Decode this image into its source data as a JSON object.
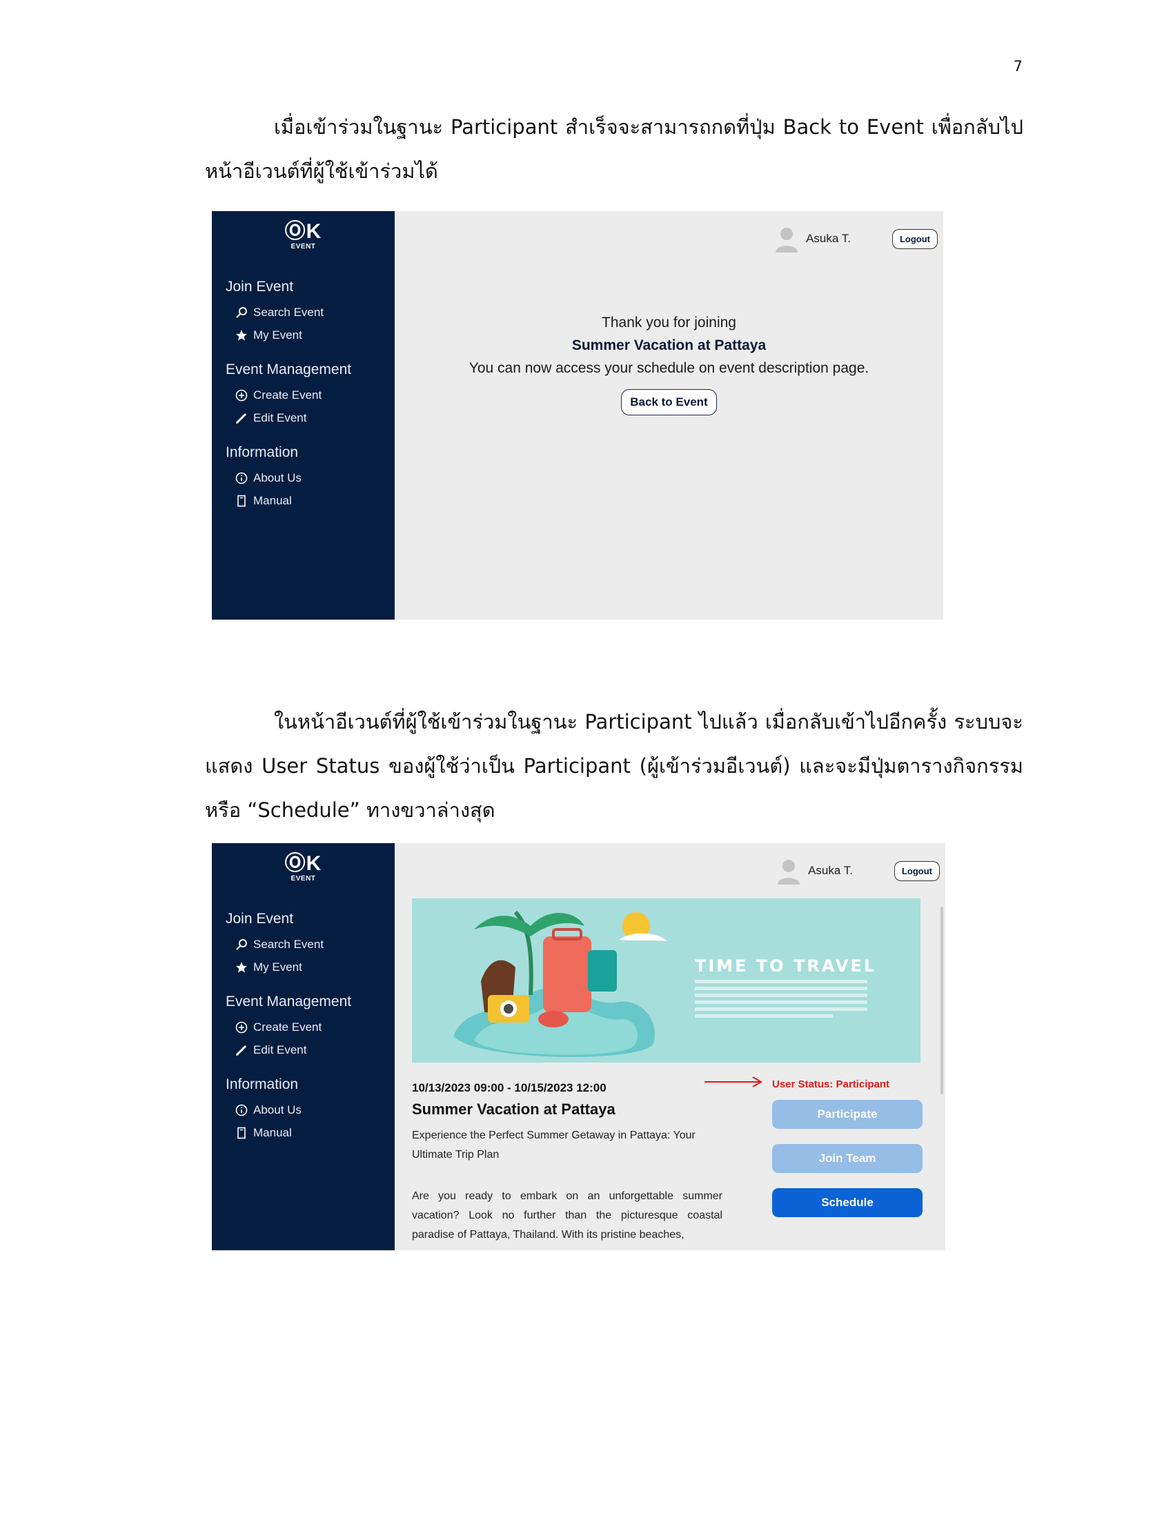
{
  "page_number": "7",
  "paragraph1": "เมื่อเข้าร่วมในฐานะ Participant สำเร็จจะสามารถกดที่ปุ่ม Back to Event เพื่อกลับไปหน้าอีเวนต์ที่ผู้ใช้เข้าร่วมได้",
  "paragraph2": "ในหน้าอีเวนต์ที่ผู้ใช้เข้าร่วมในฐานะ Participant ไปแล้ว เมื่อกลับเข้าไปอีกครั้ง ระบบจะแสดง User Status ของผู้ใช้ว่าเป็น Participant (ผู้เข้าร่วมอีเวนต์) และจะมีปุ่มตารางกิจกรรม หรือ “Schedule” ทางขวาล่างสุด",
  "app": {
    "logo_mark": "ⓄK",
    "logo_sub": "EVENT",
    "sections": {
      "join": "Join Event",
      "search": "Search Event",
      "my_event": "My Event",
      "management": "Event Management",
      "create": "Create Event",
      "edit": "Edit Event",
      "information": "Information",
      "about": "About Us",
      "manual": "Manual"
    },
    "user_name": "Asuka T.",
    "logout_label": "Logout"
  },
  "screen1": {
    "thanks_line": "Thank you  for joining",
    "event_name": "Summer Vacation at Pattaya",
    "access_line": "You can now access your schedule on event description page.",
    "back_button": "Back to Event"
  },
  "screen2": {
    "banner_text": "TIME TO TRAVEL",
    "date_range": "10/13/2023 09:00 - 10/15/2023 12:00",
    "event_title": "Summer Vacation at Pattaya",
    "summary": "Experience the Perfect Summer Getaway in Pattaya: Your Ultimate Trip Plan",
    "description": "Are you ready to embark on an unforgettable summer vacation? Look no further than the picturesque coastal paradise of Pattaya, Thailand. With its pristine beaches,",
    "user_status": "User Status: Participant",
    "participate_button": "Participate",
    "join_team_button": "Join Team",
    "schedule_button": "Schedule"
  },
  "colors": {
    "sidebar": "#041d40",
    "status_red": "#e01b1b",
    "button_disabled": "#95bde6",
    "button_primary": "#0c63d6"
  }
}
